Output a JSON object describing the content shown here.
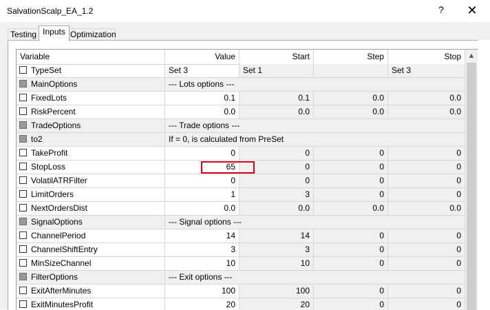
{
  "window": {
    "title": "SalvationScalp_EA_1.2",
    "help_glyph": "?",
    "close_glyph": "✕"
  },
  "tabs": [
    {
      "label": "Testing",
      "active": false
    },
    {
      "label": "Inputs",
      "active": true
    },
    {
      "label": "Optimization",
      "active": false
    }
  ],
  "columns": [
    "Variable",
    "Value",
    "Start",
    "Step",
    "Stop"
  ],
  "rows": [
    {
      "var": "TypeSet",
      "group": false,
      "value": "Set 3",
      "start": "Set 1",
      "step": "",
      "stop": "Set 3",
      "span": false,
      "align": "left"
    },
    {
      "var": "MainOptions",
      "group": true,
      "value": "---  Lots  options  ---",
      "span": true
    },
    {
      "var": "FixedLots",
      "group": false,
      "value": "0.1",
      "start": "0.1",
      "step": "0.0",
      "stop": "0.0"
    },
    {
      "var": "RiskPercent",
      "group": false,
      "value": "0.0",
      "start": "0.0",
      "step": "0.0",
      "stop": "0.0"
    },
    {
      "var": "TradeOptions",
      "group": true,
      "value": "---  Trade  options  ---",
      "span": true
    },
    {
      "var": "to2",
      "group": true,
      "value": "If = 0, is calculated from PreSet",
      "span": true
    },
    {
      "var": "TakeProfit",
      "group": false,
      "value": "0",
      "start": "0",
      "step": "0",
      "stop": "0"
    },
    {
      "var": "StopLoss",
      "group": false,
      "value": "65",
      "start": "0",
      "step": "0",
      "stop": "0"
    },
    {
      "var": "VolatilATRFilter",
      "group": false,
      "value": "0",
      "start": "0",
      "step": "0",
      "stop": "0"
    },
    {
      "var": "LimitOrders",
      "group": false,
      "value": "1",
      "start": "3",
      "step": "0",
      "stop": "0"
    },
    {
      "var": "NextOrdersDist",
      "group": false,
      "value": "0.0",
      "start": "0.0",
      "step": "0.0",
      "stop": "0.0"
    },
    {
      "var": "SignalOptions",
      "group": true,
      "value": "--- Signal options ---",
      "span": true
    },
    {
      "var": "ChannelPeriod",
      "group": false,
      "value": "14",
      "start": "14",
      "step": "0",
      "stop": "0"
    },
    {
      "var": "ChannelShiftEntry",
      "group": false,
      "value": "3",
      "start": "3",
      "step": "0",
      "stop": "0"
    },
    {
      "var": "MinSizeChannel",
      "group": false,
      "value": "10",
      "start": "10",
      "step": "0",
      "stop": "0"
    },
    {
      "var": "FilterOptions",
      "group": true,
      "value": "--- Exit options ---",
      "span": true
    },
    {
      "var": "ExitAfterMinutes",
      "group": false,
      "value": "100",
      "start": "100",
      "step": "0",
      "stop": "0"
    },
    {
      "var": "ExitMinutesProfit",
      "group": false,
      "value": "20",
      "start": "20",
      "step": "0",
      "stop": "0"
    }
  ],
  "scrollbar": {
    "up_glyph": "▲"
  },
  "accent": {
    "highlight": "#d9001b"
  }
}
